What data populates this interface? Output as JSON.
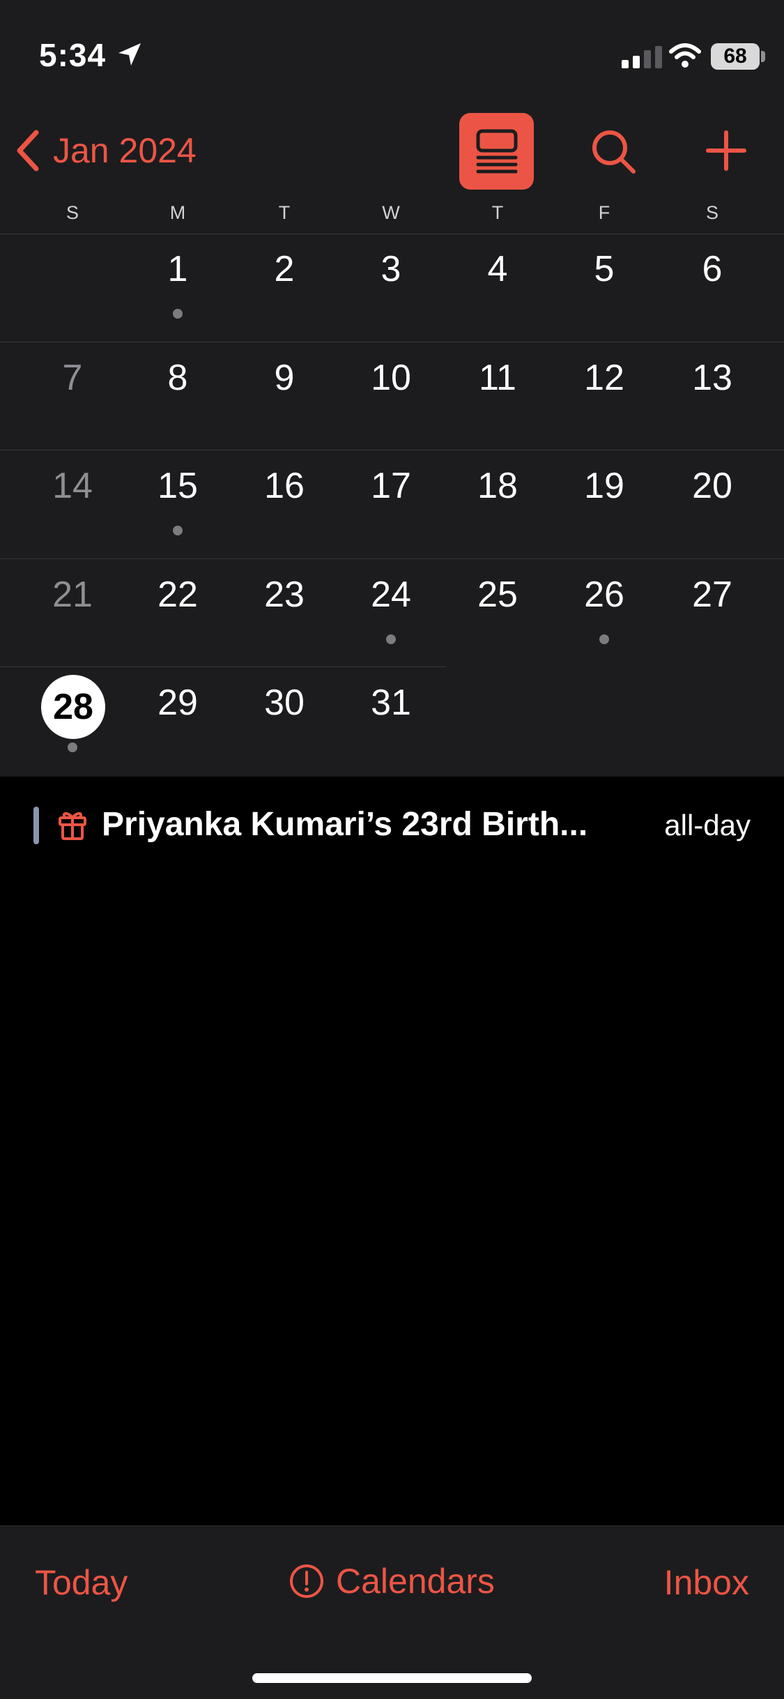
{
  "status": {
    "time": "5:34",
    "battery": "68",
    "icons": [
      "location-arrow-icon",
      "cellular-signal-icon",
      "wifi-icon",
      "battery-icon"
    ]
  },
  "nav": {
    "back_label": "Jan 2024",
    "icons": [
      "chevron-left-icon",
      "list-view-icon",
      "search-icon",
      "plus-icon"
    ],
    "accent": "#ec5545"
  },
  "weekdays": [
    "S",
    "M",
    "T",
    "W",
    "T",
    "F",
    "S"
  ],
  "calendar": {
    "month": "Jan 2024",
    "days": [
      "1",
      "2",
      "3",
      "4",
      "5",
      "6",
      "7",
      "8",
      "9",
      "10",
      "11",
      "12",
      "13",
      "14",
      "15",
      "16",
      "17",
      "18",
      "19",
      "20",
      "21",
      "22",
      "23",
      "24",
      "25",
      "26",
      "27",
      "28",
      "29",
      "30",
      "31"
    ],
    "today": "28",
    "days_with_events": [
      "1",
      "15",
      "24",
      "26",
      "28"
    ]
  },
  "event": {
    "title": "Priyanka Kumari’s 23rd Birth...",
    "time": "all-day",
    "icon": "gift-icon"
  },
  "toolbar": {
    "today_label": "Today",
    "calendars_label": "Calendars",
    "inbox_label": "Inbox",
    "calendars_icon": "exclamation-circle-icon"
  }
}
